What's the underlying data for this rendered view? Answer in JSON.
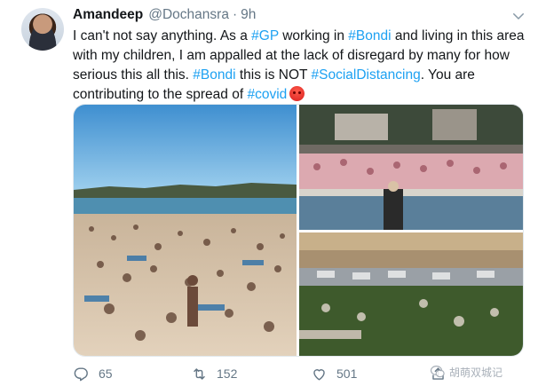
{
  "tweet": {
    "author_name": "Amandeep",
    "handle": "@Dochansra",
    "separator": "·",
    "time": "9h",
    "text_parts": [
      {
        "text": "I can't not say anything. As a ",
        "link": false
      },
      {
        "text": "#GP",
        "link": true
      },
      {
        "text": " working in ",
        "link": false
      },
      {
        "text": "#Bondi",
        "link": true
      },
      {
        "text": " and living in this area with my children, I am appalled at the lack of disregard by many for how serious this all this. ",
        "link": false
      },
      {
        "text": "#Bondi",
        "link": true
      },
      {
        "text": " this is NOT ",
        "link": false
      },
      {
        "text": "#SocialDistancing",
        "link": true
      },
      {
        "text": ". You are contributing to the spread of ",
        "link": false
      },
      {
        "text": "#covid",
        "link": true
      }
    ],
    "emoji": "angry-face"
  },
  "actions": {
    "reply_count": "65",
    "retweet_count": "152",
    "like_count": "501"
  },
  "watermark": {
    "text": "胡萌双城记"
  },
  "colors": {
    "link": "#1da1f2",
    "muted": "#657786",
    "text": "#14171a"
  },
  "icons": [
    "chevron-down-icon",
    "reply-icon",
    "retweet-icon",
    "like-icon",
    "share-icon"
  ]
}
